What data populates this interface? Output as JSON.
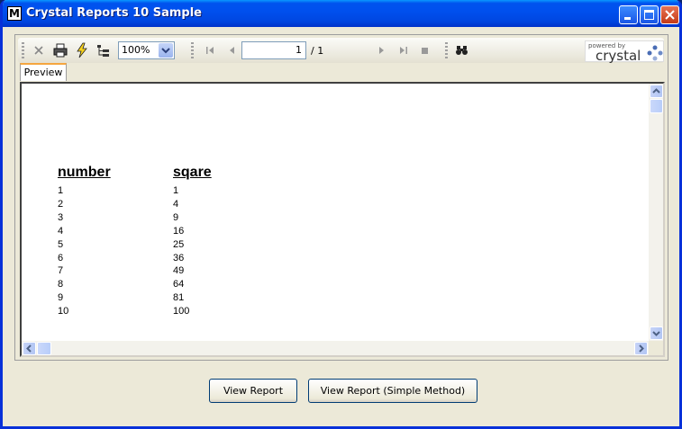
{
  "window": {
    "title": "Crystal Reports 10 Sample",
    "app_icon_letter": "M"
  },
  "toolbar": {
    "zoom_value": "100%",
    "page_current": "1",
    "page_total": "/ 1",
    "brand_small": "powered by",
    "brand_name": "crystal"
  },
  "tabs": [
    {
      "label": "Preview"
    }
  ],
  "report": {
    "headers": [
      "number",
      "sqare"
    ],
    "rows": [
      [
        "1",
        "1"
      ],
      [
        "2",
        "4"
      ],
      [
        "3",
        "9"
      ],
      [
        "4",
        "16"
      ],
      [
        "5",
        "25"
      ],
      [
        "6",
        "36"
      ],
      [
        "7",
        "49"
      ],
      [
        "8",
        "64"
      ],
      [
        "9",
        "81"
      ],
      [
        "10",
        "100"
      ]
    ]
  },
  "buttons": {
    "view_report": "View Report",
    "view_report_simple": "View Report (Simple Method)"
  },
  "colors": {
    "titlebar": "#0053ee",
    "accent_tab": "#f5a63f"
  }
}
